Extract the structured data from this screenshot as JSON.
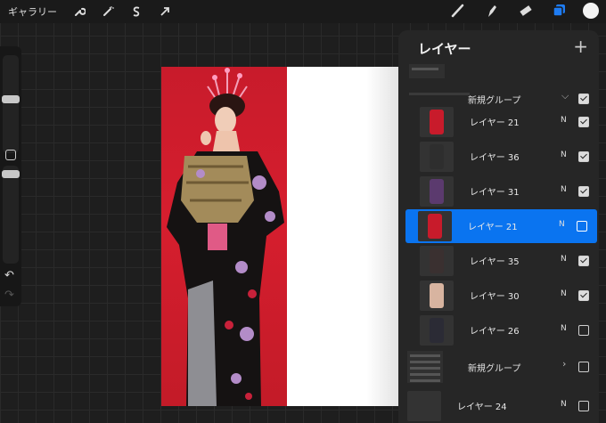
{
  "toolbar": {
    "gallery_label": "ギャラリー",
    "left_tools": [
      "wrench-icon",
      "magic-wand-icon",
      "selection-s-icon",
      "transform-arrow-icon"
    ],
    "right_tools": [
      "brush-icon",
      "smudge-icon",
      "eraser-icon",
      "layers-icon"
    ],
    "active_color": "#f3f3f3",
    "layers_active_color": "#1e7cf3"
  },
  "sidebar": {
    "brush_size_level": 0.45,
    "opacity_level": 0.55
  },
  "layers_panel": {
    "title": "レイヤー",
    "add_symbol": "+",
    "top_group": {
      "name": "新規グループ",
      "checked": true,
      "expanded": true
    },
    "layers": [
      {
        "name": "レイヤー 21",
        "mode": "N",
        "checked": true,
        "selected": false
      },
      {
        "name": "レイヤー 36",
        "mode": "N",
        "checked": true,
        "selected": false
      },
      {
        "name": "レイヤー 31",
        "mode": "N",
        "checked": true,
        "selected": false
      },
      {
        "name": "レイヤー 21",
        "mode": "N",
        "checked": false,
        "selected": true
      },
      {
        "name": "レイヤー 35",
        "mode": "N",
        "checked": true,
        "selected": false
      },
      {
        "name": "レイヤー 30",
        "mode": "N",
        "checked": true,
        "selected": false
      },
      {
        "name": "レイヤー 26",
        "mode": "N",
        "checked": false,
        "selected": false
      }
    ],
    "bottom_group": {
      "name": "新規グループ",
      "checked": false,
      "expanded": false
    },
    "last_layer": {
      "name": "レイヤー 24",
      "mode": "N",
      "checked": false
    }
  }
}
